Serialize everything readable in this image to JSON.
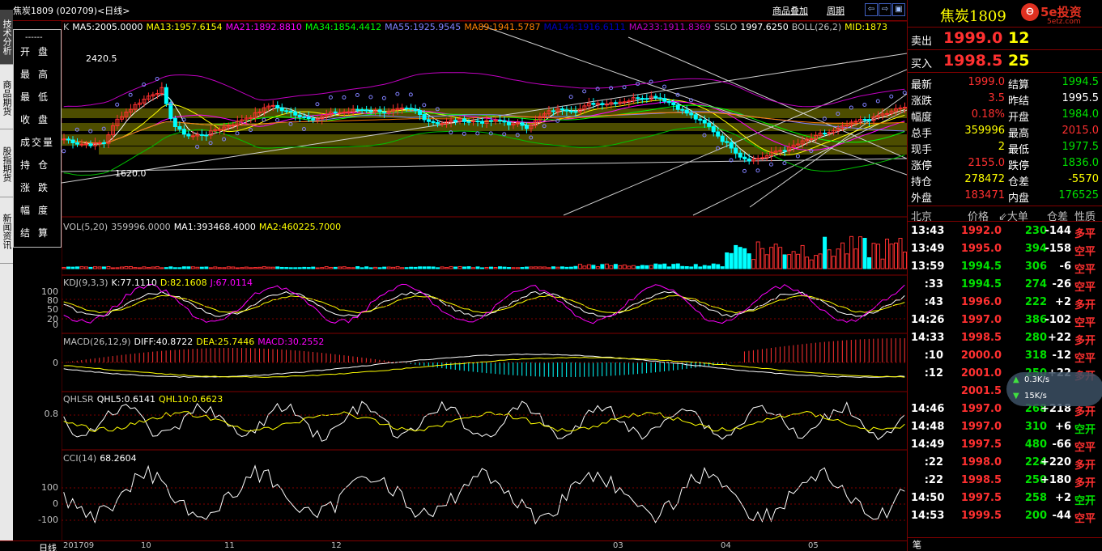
{
  "header": {
    "title": "焦炭1809 (020709)<日线>",
    "buttons": [
      "商品叠加",
      "周期"
    ],
    "win_buttons": [
      "⇦",
      "⇨",
      "▣"
    ]
  },
  "left_tabs": [
    "技术分析",
    "商品期货",
    "股指期货",
    "新闻资讯"
  ],
  "info_panel": {
    "rows": [
      "开盘",
      "最高",
      "最低",
      "收盘",
      "成交量",
      "持仓",
      "涨跌",
      "幅度",
      "结算"
    ]
  },
  "main_legend": [
    {
      "text": "K",
      "color": "#c0c0c0"
    },
    {
      "text": "MA5:2005.0000",
      "color": "#ffffff"
    },
    {
      "text": "MA13:1957.6154",
      "color": "#ffff00"
    },
    {
      "text": "MA21:1892.8810",
      "color": "#ff00ff"
    },
    {
      "text": "MA34:1854.4412",
      "color": "#00ff00"
    },
    {
      "text": "MA55:1925.9545",
      "color": "#8080ff"
    },
    {
      "text": "MA89:1941.5787",
      "color": "#ff8000"
    },
    {
      "text": "MA144:1916.6111",
      "color": "#0000c0"
    },
    {
      "text": "MA233:1911.8369",
      "color": "#c000c0"
    },
    {
      "text": "SSLO",
      "color": "#c0c0c0"
    },
    {
      "text": "1997.6250",
      "color": "#ffffff"
    },
    {
      "text": "BOLL(26,2)",
      "color": "#c0c0c0"
    },
    {
      "text": "MID:1873",
      "color": "#ffff00"
    }
  ],
  "main_annotations": {
    "high": "2420.5",
    "low": "1620.0"
  },
  "vol_legend": [
    {
      "text": "VOL(5,20)",
      "color": "#c0c0c0"
    },
    {
      "text": "359996.0000",
      "color": "#c0c0c0"
    },
    {
      "text": "MA1:393468.4000",
      "color": "#ffffff"
    },
    {
      "text": "MA2:460225.7000",
      "color": "#ffff00"
    }
  ],
  "kdj_legend": [
    {
      "text": "KDJ(9,3,3)",
      "color": "#c0c0c0"
    },
    {
      "text": "K:77.1110",
      "color": "#ffffff"
    },
    {
      "text": "D:82.1608",
      "color": "#ffff00"
    },
    {
      "text": "J:67.0114",
      "color": "#ff00ff"
    }
  ],
  "kdj_ylabels": [
    "100",
    "80",
    "50",
    "20",
    "0"
  ],
  "macd_legend": [
    {
      "text": "MACD(26,12,9)",
      "color": "#c0c0c0"
    },
    {
      "text": "DIFF:40.8722",
      "color": "#ffffff"
    },
    {
      "text": "DEA:25.7446",
      "color": "#ffff00"
    },
    {
      "text": "MACD:30.2552",
      "color": "#ff00ff"
    }
  ],
  "macd_ylabel": "0",
  "qhlsr_legend": [
    {
      "text": "QHLSR",
      "color": "#c0c0c0"
    },
    {
      "text": "QHL5:0.6141",
      "color": "#ffffff"
    },
    {
      "text": "QHL10:0.6623",
      "color": "#ffff00"
    }
  ],
  "qhlsr_ylabel": "0.8",
  "cci_legend": [
    {
      "text": "CCI(14)",
      "color": "#c0c0c0"
    },
    {
      "text": "68.2604",
      "color": "#ffffff"
    }
  ],
  "cci_ylabels": [
    "100",
    "0",
    "-100"
  ],
  "x_axis": {
    "period_label": "日线",
    "ticks": [
      "201709",
      "10",
      "11",
      "12",
      "03",
      "04",
      "05"
    ]
  },
  "quote": {
    "name": "焦炭1809",
    "logo": "5e投资",
    "logo_sub": "5etz.com",
    "sell_label": "卖出",
    "sell_price": "1999.0",
    "sell_vol": "12",
    "buy_label": "买入",
    "buy_price": "1998.5",
    "buy_vol": "25",
    "stats": [
      {
        "l1": "最新",
        "v1": "1999.0",
        "c1": "red",
        "l2": "结算",
        "v2": "1994.5",
        "c2": "green"
      },
      {
        "l1": "涨跌",
        "v1": "3.5",
        "c1": "red",
        "l2": "昨结",
        "v2": "1995.5",
        "c2": "white"
      },
      {
        "l1": "幅度",
        "v1": "0.18%",
        "c1": "red",
        "l2": "开盘",
        "v2": "1984.0",
        "c2": "green"
      },
      {
        "l1": "总手",
        "v1": "359996",
        "c1": "yellow",
        "l2": "最高",
        "v2": "2015.0",
        "c2": "red"
      },
      {
        "l1": "现手",
        "v1": "2",
        "c1": "yellow",
        "l2": "最低",
        "v2": "1977.5",
        "c2": "green"
      },
      {
        "l1": "涨停",
        "v1": "2155.0",
        "c1": "red",
        "l2": "跌停",
        "v2": "1836.0",
        "c2": "green"
      },
      {
        "l1": "持仓",
        "v1": "278472",
        "c1": "yellow",
        "l2": "仓差",
        "v2": "-5570",
        "c2": "yellow"
      },
      {
        "l1": "外盘",
        "v1": "183471",
        "c1": "red",
        "l2": "内盘",
        "v2": "176525",
        "c2": "green"
      }
    ],
    "tick_header": [
      "北京",
      "价格",
      "⇙大单",
      "仓差",
      "性质"
    ],
    "ticks": [
      {
        "t": "13:43",
        "p": "1992.0",
        "pc": "red",
        "v": "230",
        "d": "-144",
        "n": "多平",
        "nc": "red"
      },
      {
        "t": "13:49",
        "p": "1995.0",
        "pc": "red",
        "v": "394",
        "d": "-158",
        "n": "空平",
        "nc": "red"
      },
      {
        "t": "13:59",
        "p": "1994.5",
        "pc": "green",
        "v": "306",
        "d": "-6",
        "n": "空平",
        "nc": "red"
      },
      {
        "t": ":33",
        "p": "1994.5",
        "pc": "green",
        "v": "274",
        "d": "-26",
        "n": "空平",
        "nc": "red"
      },
      {
        "t": ":43",
        "p": "1996.0",
        "pc": "red",
        "v": "222",
        "d": "+2",
        "n": "多开",
        "nc": "red"
      },
      {
        "t": "14:26",
        "p": "1997.0",
        "pc": "red",
        "v": "386",
        "d": "-102",
        "n": "空平",
        "nc": "red"
      },
      {
        "t": "14:33",
        "p": "1998.5",
        "pc": "red",
        "v": "280",
        "d": "+22",
        "n": "多开",
        "nc": "red"
      },
      {
        "t": ":10",
        "p": "2000.0",
        "pc": "red",
        "v": "318",
        "d": "-12",
        "n": "空平",
        "nc": "red"
      },
      {
        "t": ":12",
        "p": "2001.0",
        "pc": "red",
        "v": "250",
        "d": "+22",
        "n": "多开",
        "nc": "red"
      },
      {
        "t": "",
        "p": "2001.5",
        "pc": "red",
        "v": "",
        "d": "",
        "n": "",
        "nc": "red"
      },
      {
        "t": "14:46",
        "p": "1997.0",
        "pc": "red",
        "v": "268",
        "d": "+218",
        "n": "多开",
        "nc": "red"
      },
      {
        "t": "14:48",
        "p": "1997.0",
        "pc": "red",
        "v": "310",
        "d": "+6",
        "n": "空开",
        "nc": "green"
      },
      {
        "t": "14:49",
        "p": "1997.5",
        "pc": "red",
        "v": "480",
        "d": "-66",
        "n": "空平",
        "nc": "red"
      },
      {
        "t": ":22",
        "p": "1998.0",
        "pc": "red",
        "v": "224",
        "d": "+220",
        "n": "多开",
        "nc": "red"
      },
      {
        "t": ":22",
        "p": "1998.5",
        "pc": "red",
        "v": "250",
        "d": "+180",
        "n": "多开",
        "nc": "red"
      },
      {
        "t": "14:50",
        "p": "1997.5",
        "pc": "red",
        "v": "258",
        "d": "+2",
        "n": "空开",
        "nc": "green"
      },
      {
        "t": "14:53",
        "p": "1999.5",
        "pc": "red",
        "v": "200",
        "d": "-44",
        "n": "空平",
        "nc": "red"
      }
    ],
    "speed": {
      "up": "0.3K/s",
      "down": "15K/s"
    },
    "footer_tab": "笔"
  },
  "colors": {
    "up": "#ff3030",
    "down": "#00ffff",
    "band": "#5a5a00",
    "grid": "#800000"
  }
}
